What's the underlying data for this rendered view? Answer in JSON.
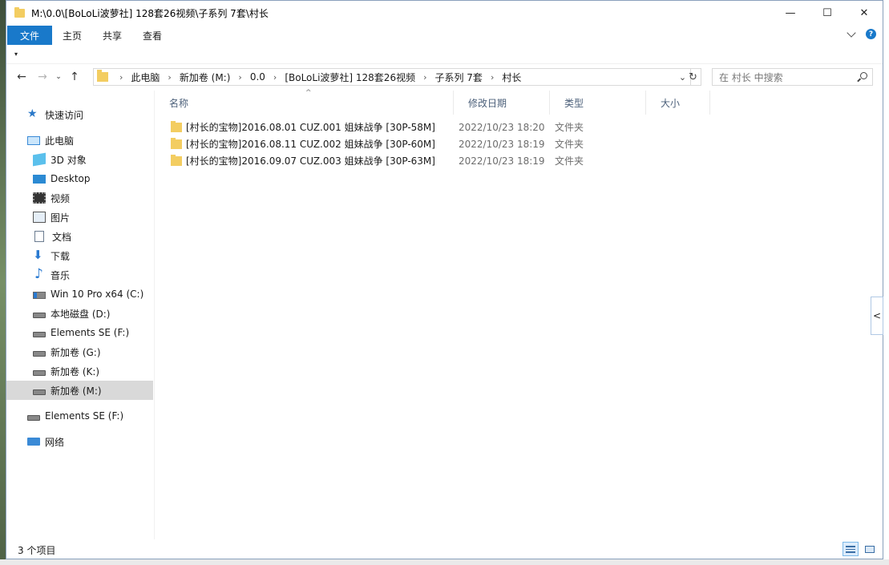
{
  "window": {
    "title": "M:\\0.0\\[BoLoLi波萝社] 128套26视频\\子系列 7套\\村长",
    "controls": {
      "minimize": "—",
      "maximize": "☐",
      "close": "✕"
    }
  },
  "ribbon": {
    "tabs": [
      "文件",
      "主页",
      "共享",
      "查看"
    ],
    "help": "?"
  },
  "quick_access_arrow": "▾",
  "nav": {
    "back": "←",
    "forward": "→",
    "recent": "⌄",
    "up": "↑",
    "breadcrumbs": [
      "此电脑",
      "新加卷 (M:)",
      "0.0",
      "[BoLoLi波萝社] 128套26视频",
      "子系列 7套",
      "村长"
    ],
    "dropdown": "⌄",
    "refresh": "↻",
    "search_placeholder": "在 村长 中搜索"
  },
  "sidebar": {
    "items": [
      {
        "label": "快速访问",
        "icon": "star-icon"
      },
      {
        "label": "此电脑",
        "icon": "pc-icon"
      },
      {
        "label": "3D 对象",
        "icon": "cube-icon"
      },
      {
        "label": "Desktop",
        "icon": "desktop-icon"
      },
      {
        "label": "视频",
        "icon": "video-icon"
      },
      {
        "label": "图片",
        "icon": "picture-icon"
      },
      {
        "label": "文档",
        "icon": "document-icon"
      },
      {
        "label": "下载",
        "icon": "download-icon"
      },
      {
        "label": "音乐",
        "icon": "music-icon"
      },
      {
        "label": "Win 10 Pro x64 (C:)",
        "icon": "windows-drive-icon"
      },
      {
        "label": "本地磁盘 (D:)",
        "icon": "drive-icon"
      },
      {
        "label": "Elements SE (F:)",
        "icon": "drive-icon"
      },
      {
        "label": "新加卷 (G:)",
        "icon": "drive-icon"
      },
      {
        "label": "新加卷 (K:)",
        "icon": "drive-icon"
      },
      {
        "label": "新加卷 (M:)",
        "icon": "drive-icon",
        "selected": true
      },
      {
        "label": "Elements SE (F:)",
        "icon": "drive-icon"
      },
      {
        "label": "网络",
        "icon": "network-icon"
      }
    ]
  },
  "columns": {
    "name": "名称",
    "date": "修改日期",
    "type": "类型",
    "size": "大小"
  },
  "files": [
    {
      "name": "[村长的宝物]2016.08.01 CUZ.001 姐妹战争 [30P-58M]",
      "date": "2022/10/23 18:20",
      "type": "文件夹"
    },
    {
      "name": "[村长的宝物]2016.08.11 CUZ.002 姐妹战争 [30P-60M]",
      "date": "2022/10/23 18:19",
      "type": "文件夹"
    },
    {
      "name": "[村长的宝物]2016.09.07 CUZ.003 姐妹战争 [30P-63M]",
      "date": "2022/10/23 18:19",
      "type": "文件夹"
    }
  ],
  "status": {
    "count": "3 个项目"
  },
  "edge_tab": "<",
  "colors": {
    "accent": "#1979ca",
    "folder": "#f3cd61",
    "selected": "#d9d9d9"
  }
}
